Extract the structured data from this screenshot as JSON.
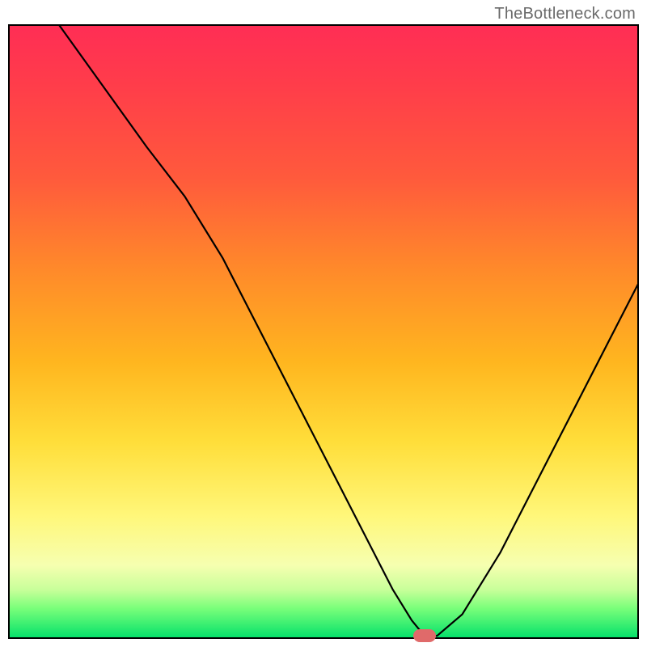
{
  "watermark": "TheBottleneck.com",
  "chart_data": {
    "type": "line",
    "title": "",
    "xlabel": "",
    "ylabel": "",
    "xlim": [
      0,
      100
    ],
    "ylim": [
      0,
      100
    ],
    "grid": false,
    "legend": false,
    "series": [
      {
        "name": "bottleneck-curve",
        "x": [
          8,
          15,
          22,
          28,
          34,
          40,
          46,
          52,
          58,
          61,
          64,
          66,
          68,
          72,
          78,
          84,
          90,
          96,
          100
        ],
        "y": [
          100,
          90,
          80,
          72,
          62,
          50,
          38,
          26,
          14,
          8,
          3,
          0.5,
          0.5,
          4,
          14,
          26,
          38,
          50,
          58
        ]
      }
    ],
    "marker": {
      "x": 66,
      "y": 0.5,
      "color": "#e06a6a",
      "shape": "pill"
    },
    "background_gradient": {
      "stops": [
        {
          "pos": 0.0,
          "color": "#ff2d55"
        },
        {
          "pos": 0.25,
          "color": "#ff5a3c"
        },
        {
          "pos": 0.55,
          "color": "#ffb61f"
        },
        {
          "pos": 0.8,
          "color": "#fff77a"
        },
        {
          "pos": 0.95,
          "color": "#7aff7a"
        },
        {
          "pos": 1.0,
          "color": "#00e06a"
        }
      ]
    }
  }
}
